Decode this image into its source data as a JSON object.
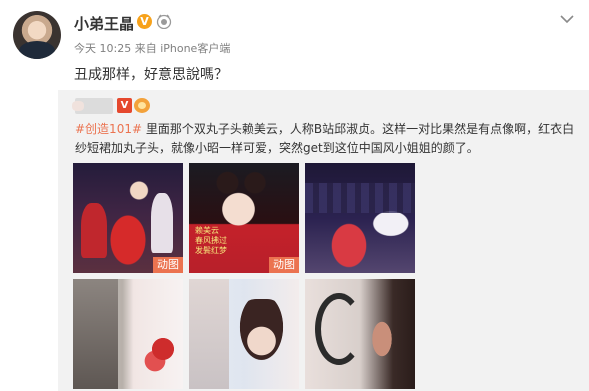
{
  "post": {
    "username": "小弟王晶",
    "vip_badge": "V",
    "meta": "今天 10:25 来自 iPhone客户端",
    "text": "丑成那样，好意思說嗎？"
  },
  "repost": {
    "source_badge": "V",
    "hashtag": "#创造101#",
    "text": " 里面那个双丸子头赖美云，人称B站邱淑贞。这样一对比果然是有点像啊，红衣白纱短裙加丸子头，就像小昭一样可爱，突然get到这位中国风小姐姐的颜了。",
    "images": [
      {
        "gif": "动图"
      },
      {
        "gif": "动图",
        "caption": "赖美云\n春风拂过\n发鬓红梦"
      },
      {
        "gif": ""
      },
      {
        "gif": ""
      },
      {
        "gif": ""
      },
      {
        "gif": ""
      }
    ]
  },
  "icons": {
    "vip": "vip-v-icon",
    "rank": "rank-icon",
    "menu": "chevron-down-icon"
  },
  "colors": {
    "hashtag": "#eb7350",
    "vip": "#f7a21b",
    "repost_bg": "#f2f2f2"
  }
}
